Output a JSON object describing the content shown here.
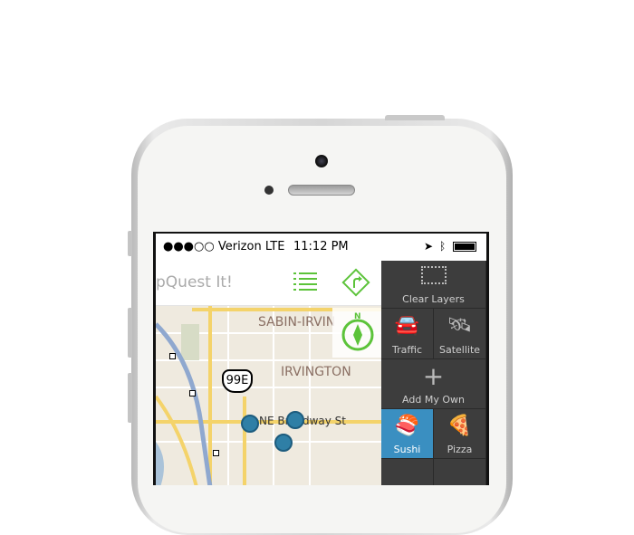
{
  "status": {
    "carrier": "●●●○○ Verizon LTE",
    "time": "11:12 PM",
    "icons": [
      "location-arrow-icon",
      "bluetooth-icon",
      "battery-icon"
    ]
  },
  "header": {
    "title": "pQuest It!",
    "icons": [
      "list-icon",
      "directions-icon"
    ]
  },
  "map": {
    "labels": [
      "SABIN-IRVIN",
      "IRVINGTON",
      "NE Broadway St",
      "99E"
    ],
    "compass": "N",
    "accent": "#5cc33a"
  },
  "layers": {
    "items": [
      {
        "label": "Clear Layers",
        "icon": "clear-layers-icon"
      },
      {
        "label": "Traffic",
        "icon": "traffic-icon"
      },
      {
        "label": "Satellite",
        "icon": "satellite-icon"
      },
      {
        "label": "Add My Own",
        "icon": "plus-icon"
      },
      {
        "label": "Sushi",
        "icon": "sushi-icon",
        "selected": true
      },
      {
        "label": "Pizza",
        "icon": "pizza-icon"
      }
    ],
    "selected_color": "#3a8fc1"
  }
}
